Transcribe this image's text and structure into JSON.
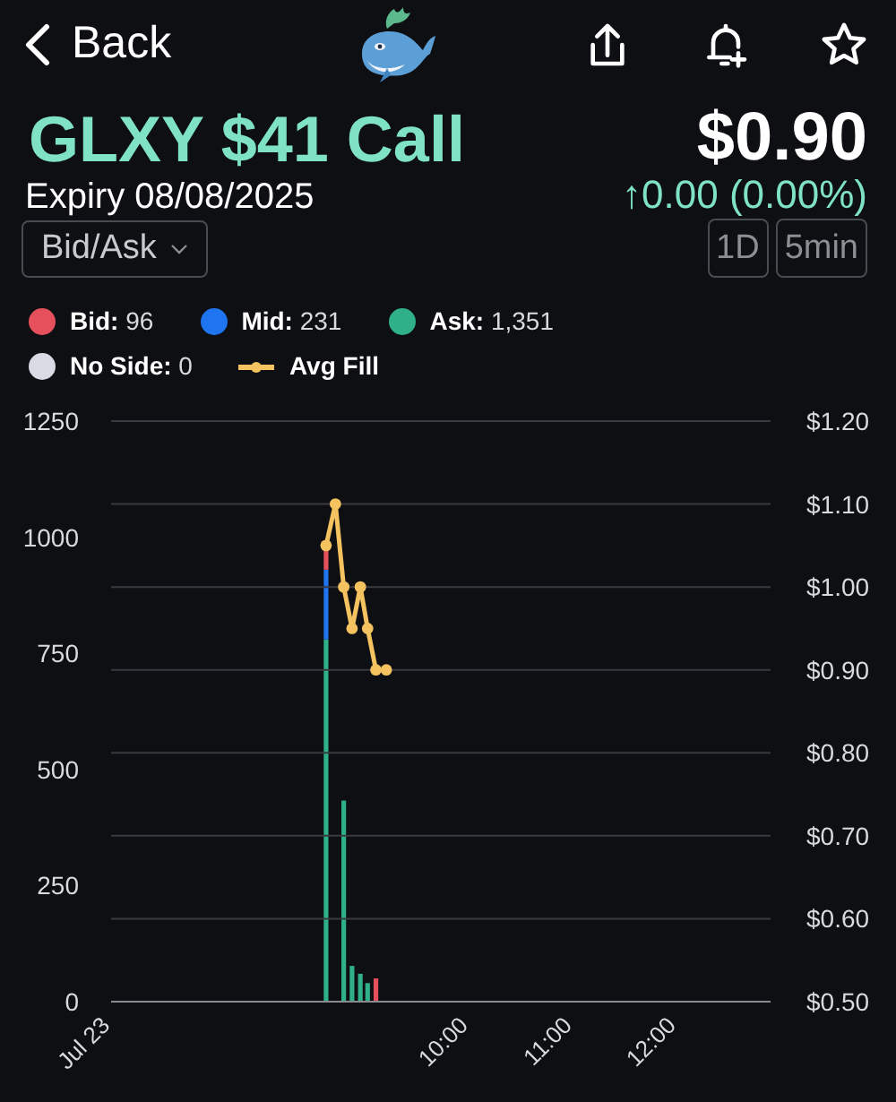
{
  "header": {
    "back_label": "Back"
  },
  "contract": {
    "title": "GLXY $41 Call",
    "price": "$0.90",
    "expiry": "Expiry 08/08/2025",
    "change": "↑0.00 (0.00%)"
  },
  "controls": {
    "dropdown": "Bid/Ask",
    "ranges": [
      {
        "label": "1D"
      },
      {
        "label": "5min"
      }
    ]
  },
  "legend": [
    {
      "kind": "dot",
      "label": "Bid:",
      "value": "96",
      "color": "#e5505c"
    },
    {
      "kind": "dot",
      "label": "Mid:",
      "value": "231",
      "color": "#1f74f0"
    },
    {
      "kind": "dot",
      "label": "Ask:",
      "value": "1,351",
      "color": "#2fb086"
    },
    {
      "kind": "dot",
      "label": "No Side:",
      "value": "0",
      "color": "#d8dbe3"
    },
    {
      "kind": "line",
      "label": "Avg Fill",
      "color": "#f5c260"
    }
  ],
  "charts": [
    {
      "chart_data": {
        "type": "bar",
        "stacked": true,
        "x": [
          8.62,
          8.79,
          8.87,
          8.95,
          9.02,
          9.1
        ],
        "xlim": [
          6.55,
          12.9
        ],
        "xticks": [
          {
            "value": 6.55,
            "label": "Jul 23"
          },
          {
            "value": 10,
            "label": "10:00"
          },
          {
            "value": 11,
            "label": "11:00"
          },
          {
            "value": 12,
            "label": "12:00"
          }
        ],
        "ylim": [
          0,
          1250
        ],
        "yticks": [
          0,
          250,
          500,
          750,
          1000,
          1250
        ],
        "series": [
          {
            "color": "#2fb086",
            "values": [
              780,
              433,
              77,
              60,
              40,
              null
            ]
          },
          {
            "color": "#1f74f0",
            "values": [
              150,
              null,
              null,
              null,
              null,
              null
            ]
          },
          {
            "color": "#e5505c",
            "values": [
              46,
              null,
              null,
              null,
              null,
              50
            ]
          }
        ]
      }
    },
    {
      "chart_data": {
        "type": "line",
        "grid": true,
        "x": [
          8.62,
          8.71,
          8.79,
          8.87,
          8.95,
          9.02,
          9.1,
          9.2
        ],
        "xlim": [
          6.55,
          12.9
        ],
        "ylim": [
          0.5,
          1.2
        ],
        "yticks": [
          {
            "value": 0.5,
            "label": "$0.50"
          },
          {
            "value": 0.6,
            "label": "$0.60"
          },
          {
            "value": 0.7,
            "label": "$0.70"
          },
          {
            "value": 0.8,
            "label": "$0.80"
          },
          {
            "value": 0.9,
            "label": "$0.90"
          },
          {
            "value": 1.0,
            "label": "$1.00"
          },
          {
            "value": 1.1,
            "label": "$1.10"
          },
          {
            "value": 1.2,
            "label": "$1.20"
          }
        ],
        "series": [
          {
            "color": "#f5c260",
            "marker": "circle",
            "values": [
              1.05,
              1.1,
              1.0,
              0.95,
              1.0,
              0.95,
              0.9,
              0.9
            ]
          }
        ]
      }
    }
  ]
}
